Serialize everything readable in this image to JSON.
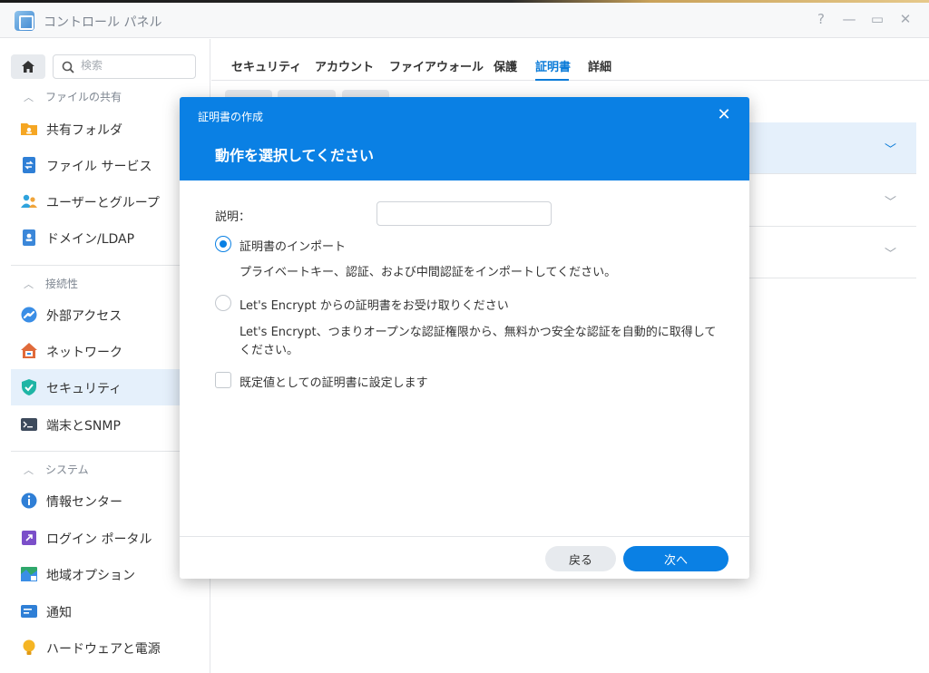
{
  "window": {
    "title": "コントロール パネル",
    "controls": {
      "help": "?",
      "minimize": "—",
      "maximize": "▭",
      "close": "✕"
    }
  },
  "sidebar": {
    "search_placeholder": "検索",
    "sections": [
      {
        "label": "ファイルの共有",
        "items": [
          {
            "label": "共有フォルダ",
            "icon": "shared-folder-icon",
            "color": "#f5a623"
          },
          {
            "label": "ファイル サービス",
            "icon": "file-services-icon",
            "color": "#2f7fd6"
          },
          {
            "label": "ユーザーとグループ",
            "icon": "users-groups-icon",
            "color": "#2fa3dd"
          },
          {
            "label": "ドメイン/LDAP",
            "icon": "domain-ldap-icon",
            "color": "#3b87d9"
          }
        ]
      },
      {
        "label": "接続性",
        "items": [
          {
            "label": "外部アクセス",
            "icon": "external-access-icon",
            "color": "#3a8ee6"
          },
          {
            "label": "ネットワーク",
            "icon": "network-icon",
            "color": "#e06a3a"
          },
          {
            "label": "セキュリティ",
            "icon": "security-shield-icon",
            "color": "#1fb5a5",
            "active": true
          },
          {
            "label": "端末とSNMP",
            "icon": "terminal-snmp-icon",
            "color": "#3d4a5c"
          }
        ]
      },
      {
        "label": "システム",
        "items": [
          {
            "label": "情報センター",
            "icon": "info-center-icon",
            "color": "#2f7fd6"
          },
          {
            "label": "ログイン ポータル",
            "icon": "login-portal-icon",
            "color": "#7b4fc9"
          },
          {
            "label": "地域オプション",
            "icon": "regional-options-icon",
            "color": "#2fa86b"
          },
          {
            "label": "通知",
            "icon": "notification-icon",
            "color": "#2f7fd6"
          },
          {
            "label": "ハードウェアと電源",
            "icon": "hardware-power-icon",
            "color": "#f5b524"
          }
        ]
      }
    ]
  },
  "main": {
    "tabs": [
      "セキュリティ",
      "アカウント",
      "ファイアウォール",
      "保護",
      "証明書",
      "詳細"
    ],
    "active_tab": "証明書"
  },
  "dialog": {
    "title": "証明書の作成",
    "close_icon": "close-icon",
    "heading": "動作を選択してください",
    "description_label": "説明：",
    "description_value": "",
    "options": [
      {
        "label": "証明書のインポート",
        "description": "プライベートキー、認証、および中間認証をインポートしてください。",
        "selected": true
      },
      {
        "label": "Let's Encrypt からの証明書をお受け取りください",
        "description": "Let's Encrypt、つまりオープンな認証権限から、無料かつ安全な認証を自動的に取得してください。",
        "selected": false
      }
    ],
    "default_checkbox_label": "既定値としての証明書に設定します",
    "default_checked": false,
    "back_button": "戻る",
    "next_button": "次へ"
  },
  "colors": {
    "accent": "#0a80e4",
    "active_bg": "#e5f0fb"
  }
}
